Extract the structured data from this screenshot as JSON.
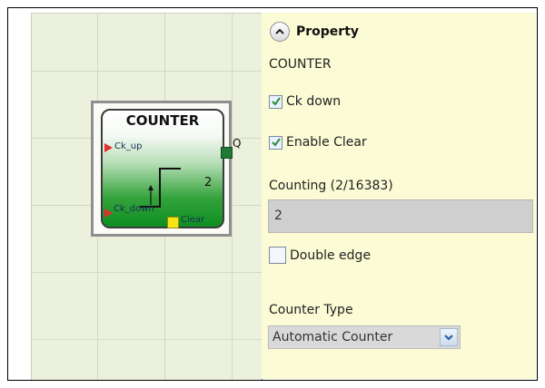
{
  "canvas": {
    "block": {
      "title": "COUNTER",
      "input_up": "Ck_up",
      "input_down": "Ck_down",
      "output": "Q",
      "clear": "Clear",
      "count_display": "2"
    }
  },
  "property_panel": {
    "title": "Property",
    "component_name": "COUNTER",
    "ck_down": {
      "label": "Ck down",
      "checked": true
    },
    "enable_clear": {
      "label": "Enable Clear",
      "checked": true
    },
    "counting": {
      "label": "Counting (2/16383)",
      "value": "2"
    },
    "double_edge": {
      "label": "Double edge",
      "checked": false
    },
    "counter_type": {
      "label": "Counter Type",
      "value": "Automatic Counter"
    }
  },
  "icons": {
    "collapse": "chevron-up-icon",
    "dropdown": "chevron-down-icon",
    "checkmark": "checkmark-icon"
  },
  "colors": {
    "canvas_bg": "#ebf1dc",
    "panel_bg": "#fbfbd5",
    "block_green": "#0d8f22",
    "input_pin": "#e0302a",
    "clear_pin": "#f5e617",
    "output_pin": "#1f7a36"
  }
}
